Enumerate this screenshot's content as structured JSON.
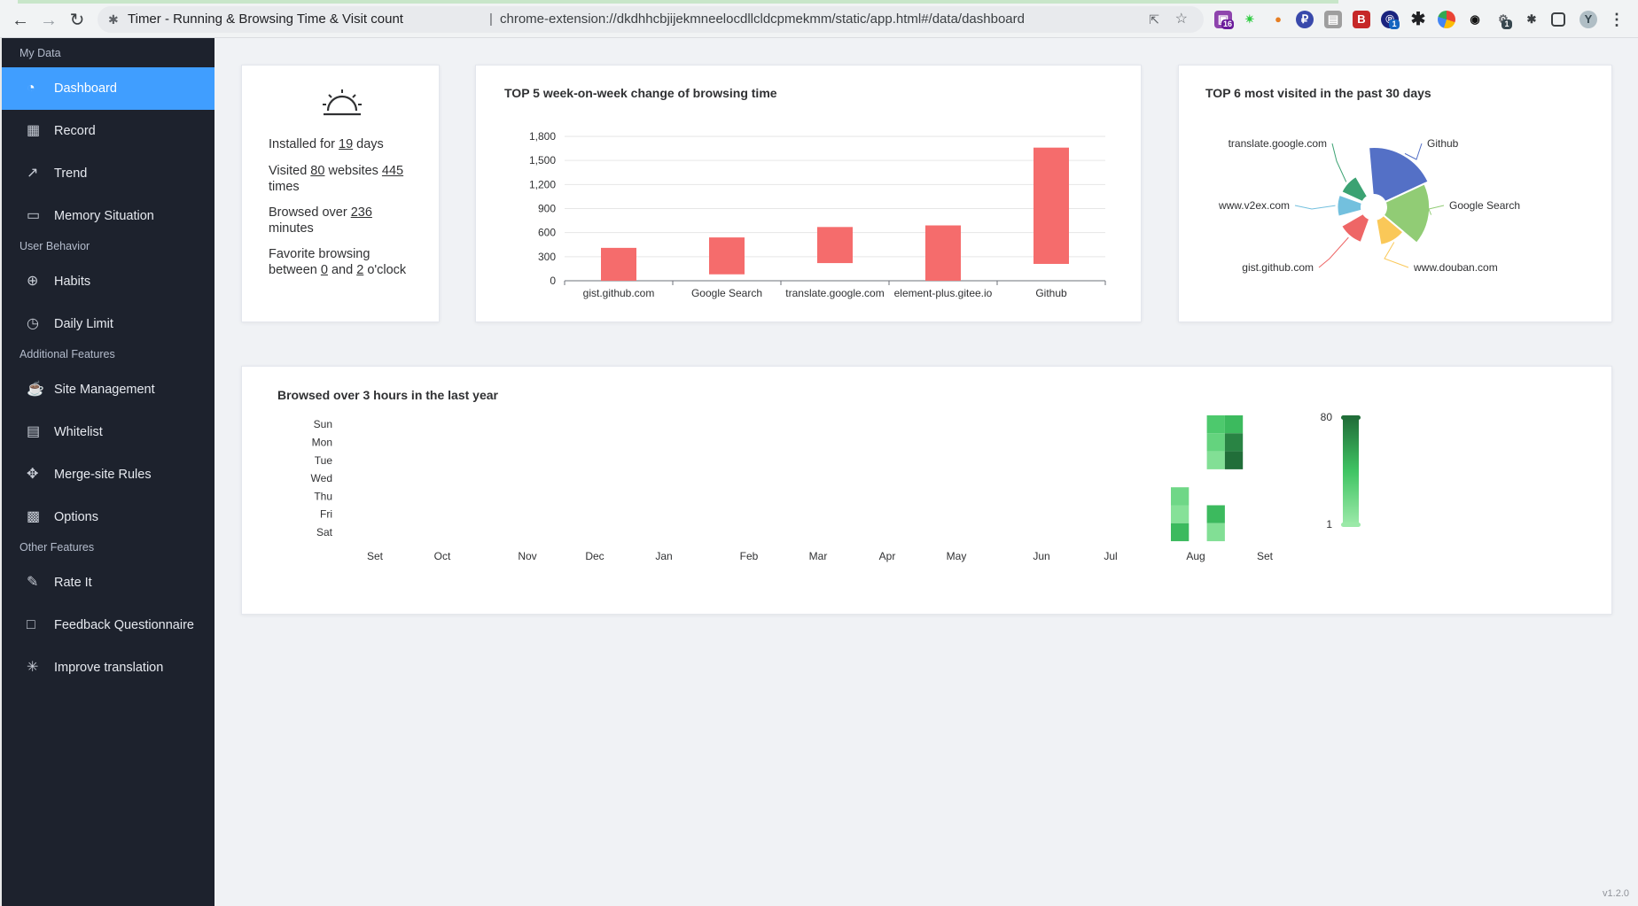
{
  "browser": {
    "page_title": "Timer - Running & Browsing Time & Visit count",
    "separator": "|",
    "url": "chrome-extension://dkdhhcbjijekmneelocdllcldcpmekmm/static/app.html#/data/dashboard",
    "ext_badges": [
      "16",
      "1",
      "1"
    ]
  },
  "sidebar": {
    "groups": [
      {
        "title": "My Data",
        "items": [
          {
            "label": "Dashboard",
            "icon": "dashboard-icon",
            "active": true
          },
          {
            "label": "Record",
            "icon": "calendar-icon"
          },
          {
            "label": "Trend",
            "icon": "trend-icon"
          },
          {
            "label": "Memory Situation",
            "icon": "folder-icon"
          }
        ]
      },
      {
        "title": "User Behavior",
        "items": [
          {
            "label": "Habits",
            "icon": "aim-icon"
          },
          {
            "label": "Daily Limit",
            "icon": "timer-icon"
          }
        ]
      },
      {
        "title": "Additional Features",
        "items": [
          {
            "label": "Site Management",
            "icon": "coffee-cup-icon"
          },
          {
            "label": "Whitelist",
            "icon": "tickets-icon"
          },
          {
            "label": "Merge-site Rules",
            "icon": "rank-icon"
          },
          {
            "label": "Options",
            "icon": "set-up-icon"
          }
        ]
      },
      {
        "title": "Other Features",
        "items": [
          {
            "label": "Rate It",
            "icon": "star-pen-icon"
          },
          {
            "label": "Feedback Questionnaire",
            "icon": "chat-icon"
          },
          {
            "label": "Improve translation",
            "icon": "loading-icon"
          }
        ]
      }
    ]
  },
  "summary": {
    "icon": "sunrise-icon",
    "installed_prefix": "Installed for",
    "installed_days": "19",
    "installed_suffix": "days",
    "visited_prefix": "Visited",
    "visited_sites": "80",
    "visited_mid": "websites",
    "visited_times": "445",
    "visited_suffix": "times",
    "browsed_prefix": "Browsed over",
    "browsed_minutes": "236",
    "browsed_suffix": "minutes",
    "fav_prefix": "Favorite browsing between",
    "fav_from": "0",
    "fav_mid": "and",
    "fav_to": "2",
    "fav_suffix": "o'clock"
  },
  "chart_data": [
    {
      "type": "bar",
      "title": "TOP 5 week-on-week change of browsing time",
      "categories": [
        "gist.github.com",
        "Google Search",
        "translate.google.com",
        "element-plus.gitee.io",
        "Github"
      ],
      "ranges": [
        [
          0,
          410
        ],
        [
          80,
          540
        ],
        [
          220,
          670
        ],
        [
          0,
          690
        ],
        [
          210,
          1660
        ]
      ],
      "yticks": [
        "0",
        "300",
        "600",
        "900",
        "1,200",
        "1,500",
        "1,800"
      ],
      "ylim": [
        0,
        1800
      ],
      "color": "#f56c6c"
    },
    {
      "type": "pie",
      "title": "TOP 6 most visited in the past 30 days",
      "style": "rose",
      "labels": [
        "Github",
        "Google Search",
        "www.douban.com",
        "gist.github.com",
        "www.v2ex.com",
        "translate.google.com"
      ],
      "values": [
        100,
        80,
        22,
        20,
        18,
        16
      ],
      "colors": [
        "#5470c6",
        "#91cc75",
        "#fac858",
        "#ee6666",
        "#73c0de",
        "#3ba272"
      ]
    },
    {
      "type": "heatmap",
      "title": "Browsed over 3 hours in the last year",
      "y_labels": [
        "Sun",
        "Mon",
        "Tue",
        "Wed",
        "Thu",
        "Fri",
        "Sat"
      ],
      "x_labels": [
        "Set",
        "Oct",
        "Nov",
        "Dec",
        "Jan",
        "Feb",
        "Mar",
        "Apr",
        "May",
        "Jun",
        "Jul",
        "Aug",
        "Set"
      ],
      "cells": [
        {
          "week": 49,
          "day": 4,
          "value": 20
        },
        {
          "week": 49,
          "day": 5,
          "value": 10
        },
        {
          "week": 49,
          "day": 6,
          "value": 45
        },
        {
          "week": 51,
          "day": 0,
          "value": 35
        },
        {
          "week": 51,
          "day": 1,
          "value": 25
        },
        {
          "week": 51,
          "day": 2,
          "value": 12
        },
        {
          "week": 51,
          "day": 5,
          "value": 45
        },
        {
          "week": 51,
          "day": 6,
          "value": 12
        },
        {
          "week": 52,
          "day": 0,
          "value": 45
        },
        {
          "week": 52,
          "day": 1,
          "value": 70
        },
        {
          "week": 52,
          "day": 2,
          "value": 80
        }
      ],
      "visual_map": {
        "min": 1,
        "max": 80,
        "min_label": "1",
        "max_label": "80",
        "colors": [
          "#9be9a8",
          "#40c463",
          "#216e39"
        ]
      }
    }
  ],
  "version": "v1.2.0"
}
